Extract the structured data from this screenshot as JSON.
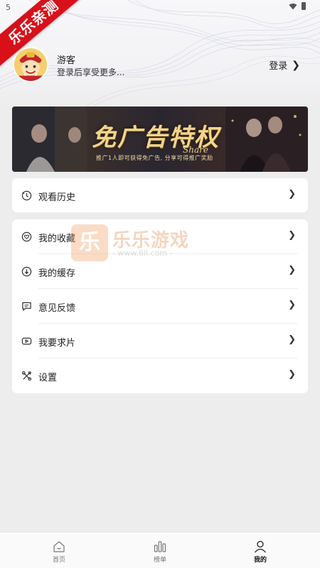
{
  "status_bar": {
    "time": "5"
  },
  "ribbon": {
    "text": "乐乐亲测"
  },
  "profile": {
    "name": "游客",
    "subtitle": "登录后享受更多...",
    "login_label": "登录",
    "login_chevron": "❯"
  },
  "banner": {
    "title": "免广告特权",
    "share": "Share",
    "subtitle": "推广1人即可获得免广告, 分享可得推广奖励"
  },
  "history_card": {
    "items": [
      {
        "label": "观看历史",
        "icon": "clock-icon"
      }
    ]
  },
  "menu_card": {
    "items": [
      {
        "label": "我的收藏",
        "icon": "heart-icon"
      },
      {
        "label": "我的缓存",
        "icon": "download-icon"
      },
      {
        "label": "意见反馈",
        "icon": "message-icon"
      },
      {
        "label": "我要求片",
        "icon": "video-icon"
      },
      {
        "label": "设置",
        "icon": "tools-icon"
      }
    ]
  },
  "row_chevron": "❯",
  "watermark": {
    "logo_char": "乐",
    "name": "乐乐游戏",
    "url": "- www.6ll.com -"
  },
  "bottom_nav": {
    "items": [
      {
        "label": "首页",
        "icon": "home-icon"
      },
      {
        "label": "榜单",
        "icon": "chart-icon"
      },
      {
        "label": "我的",
        "icon": "user-icon",
        "active": true
      }
    ]
  },
  "colors": {
    "ribbon": "#d8101a",
    "background": "#ededed",
    "card": "#ffffff",
    "banner_gold": "#f2d58a"
  }
}
